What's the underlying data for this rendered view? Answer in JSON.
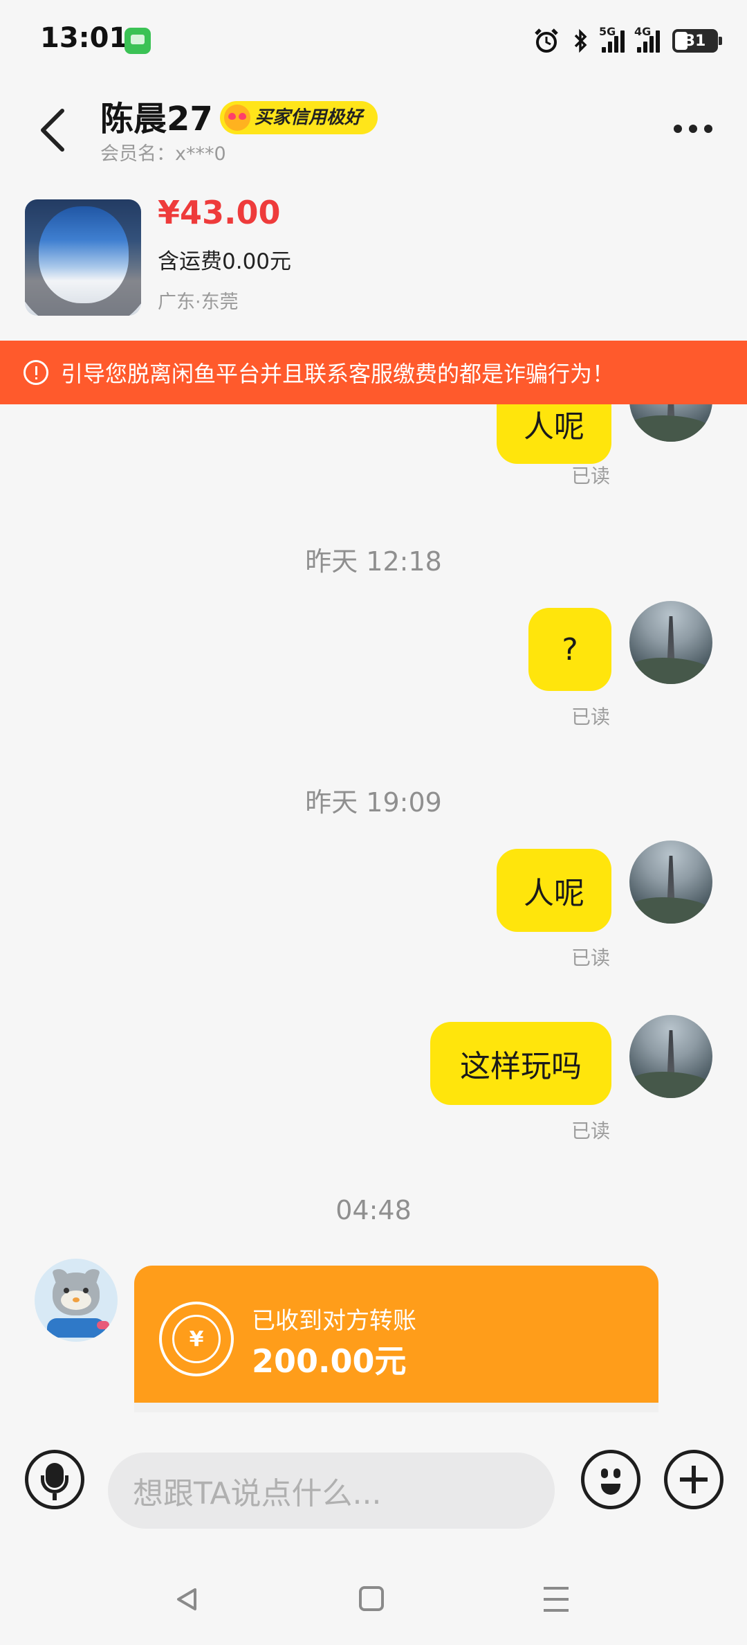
{
  "status_bar": {
    "time": "13:01",
    "net_a": "5G",
    "net_b": "4G",
    "battery": "31",
    "icons": [
      "notification-app-icon",
      "alarm-icon",
      "bluetooth-icon",
      "signal-icon",
      "battery-icon"
    ]
  },
  "header": {
    "name": "陈晨27",
    "badge": "买家信用极好",
    "member": "会员名：x***0"
  },
  "product": {
    "price": "¥43.00",
    "shipping": "含运费0.00元",
    "location": "广东·东莞"
  },
  "warning": {
    "text": "引导您脱离闲鱼平台并且联系客服缴费的都是诈骗行为！",
    "color": "#ff5a2c"
  },
  "messages": [
    {
      "text": "人呢",
      "status": "已读"
    },
    {
      "time": "昨天 12:18"
    },
    {
      "text": "?",
      "status": "已读"
    },
    {
      "time": "昨天 19:09"
    },
    {
      "text": "人呢",
      "status": "已读"
    },
    {
      "text": "这样玩吗",
      "status": "已读"
    },
    {
      "time": "04:48"
    }
  ],
  "transfer": {
    "title": "已收到对方转账",
    "amount": "200.00元",
    "symbol": "¥"
  },
  "input": {
    "placeholder": "想跟TA说点什么..."
  },
  "colors": {
    "bubble": "#ffe50c",
    "transfer": "#ff9d1a",
    "price": "#ee3b3b"
  }
}
